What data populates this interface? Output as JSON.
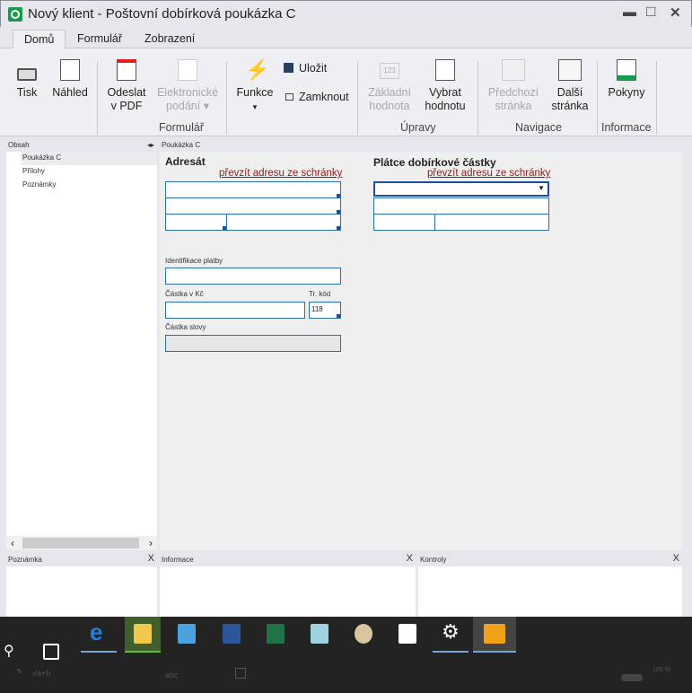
{
  "window": {
    "title": "Nový klient - Poštovní dobírková poukázka C",
    "minimize": "▬",
    "maximize": "□",
    "close": "✕"
  },
  "tabs": [
    "Domů",
    "Formulář",
    "Zobrazení"
  ],
  "ribbon": {
    "tisk": "Tisk",
    "nahled": "Náhled",
    "odeslat1": "Odeslat",
    "odeslat2": "v PDF",
    "elektronicke1": "Elektronické",
    "elektronicke2": "podání ▾",
    "funkce": "Funkce",
    "funkce_arrow": "▾",
    "ulozit": "Uložit",
    "zamknout": "Zamknout",
    "zakladni1": "Základní",
    "zakladni2": "hodnota",
    "vybrat1": "Vybrat",
    "vybrat2": "hodnotu",
    "predchozi1": "Předchozí",
    "predchozi2": "stránka",
    "dalsi1": "Další",
    "dalsi2": "stránka",
    "pokyny": "Pokyny",
    "groups": {
      "formular": "Formulář",
      "upravy": "Úpravy",
      "navigace": "Navigace",
      "informace": "Informace"
    }
  },
  "sidebar": {
    "title": "Obsah",
    "items": [
      "Poukázka C",
      "Přílohy",
      "Poznámky"
    ],
    "scroll_left": "‹",
    "scroll_right": "›"
  },
  "form": {
    "header": "Poukázka C",
    "adresat": "Adresát",
    "platce": "Plátce dobírkové částky",
    "link": "převzít adresu ze schránky",
    "identifikace": "Identifikace platby",
    "castka": "Částka v Kč",
    "trkod": "Tr. kód",
    "trkod_value": "118",
    "slovy": "Částka slovy"
  },
  "panels": {
    "poznamka": "Poznámka",
    "informace": "Informace",
    "kontroly": "Kontroly",
    "close": "X"
  },
  "status": {
    "abc": "abc",
    "zoom": "100 %",
    "sqrt": "√a+b"
  }
}
